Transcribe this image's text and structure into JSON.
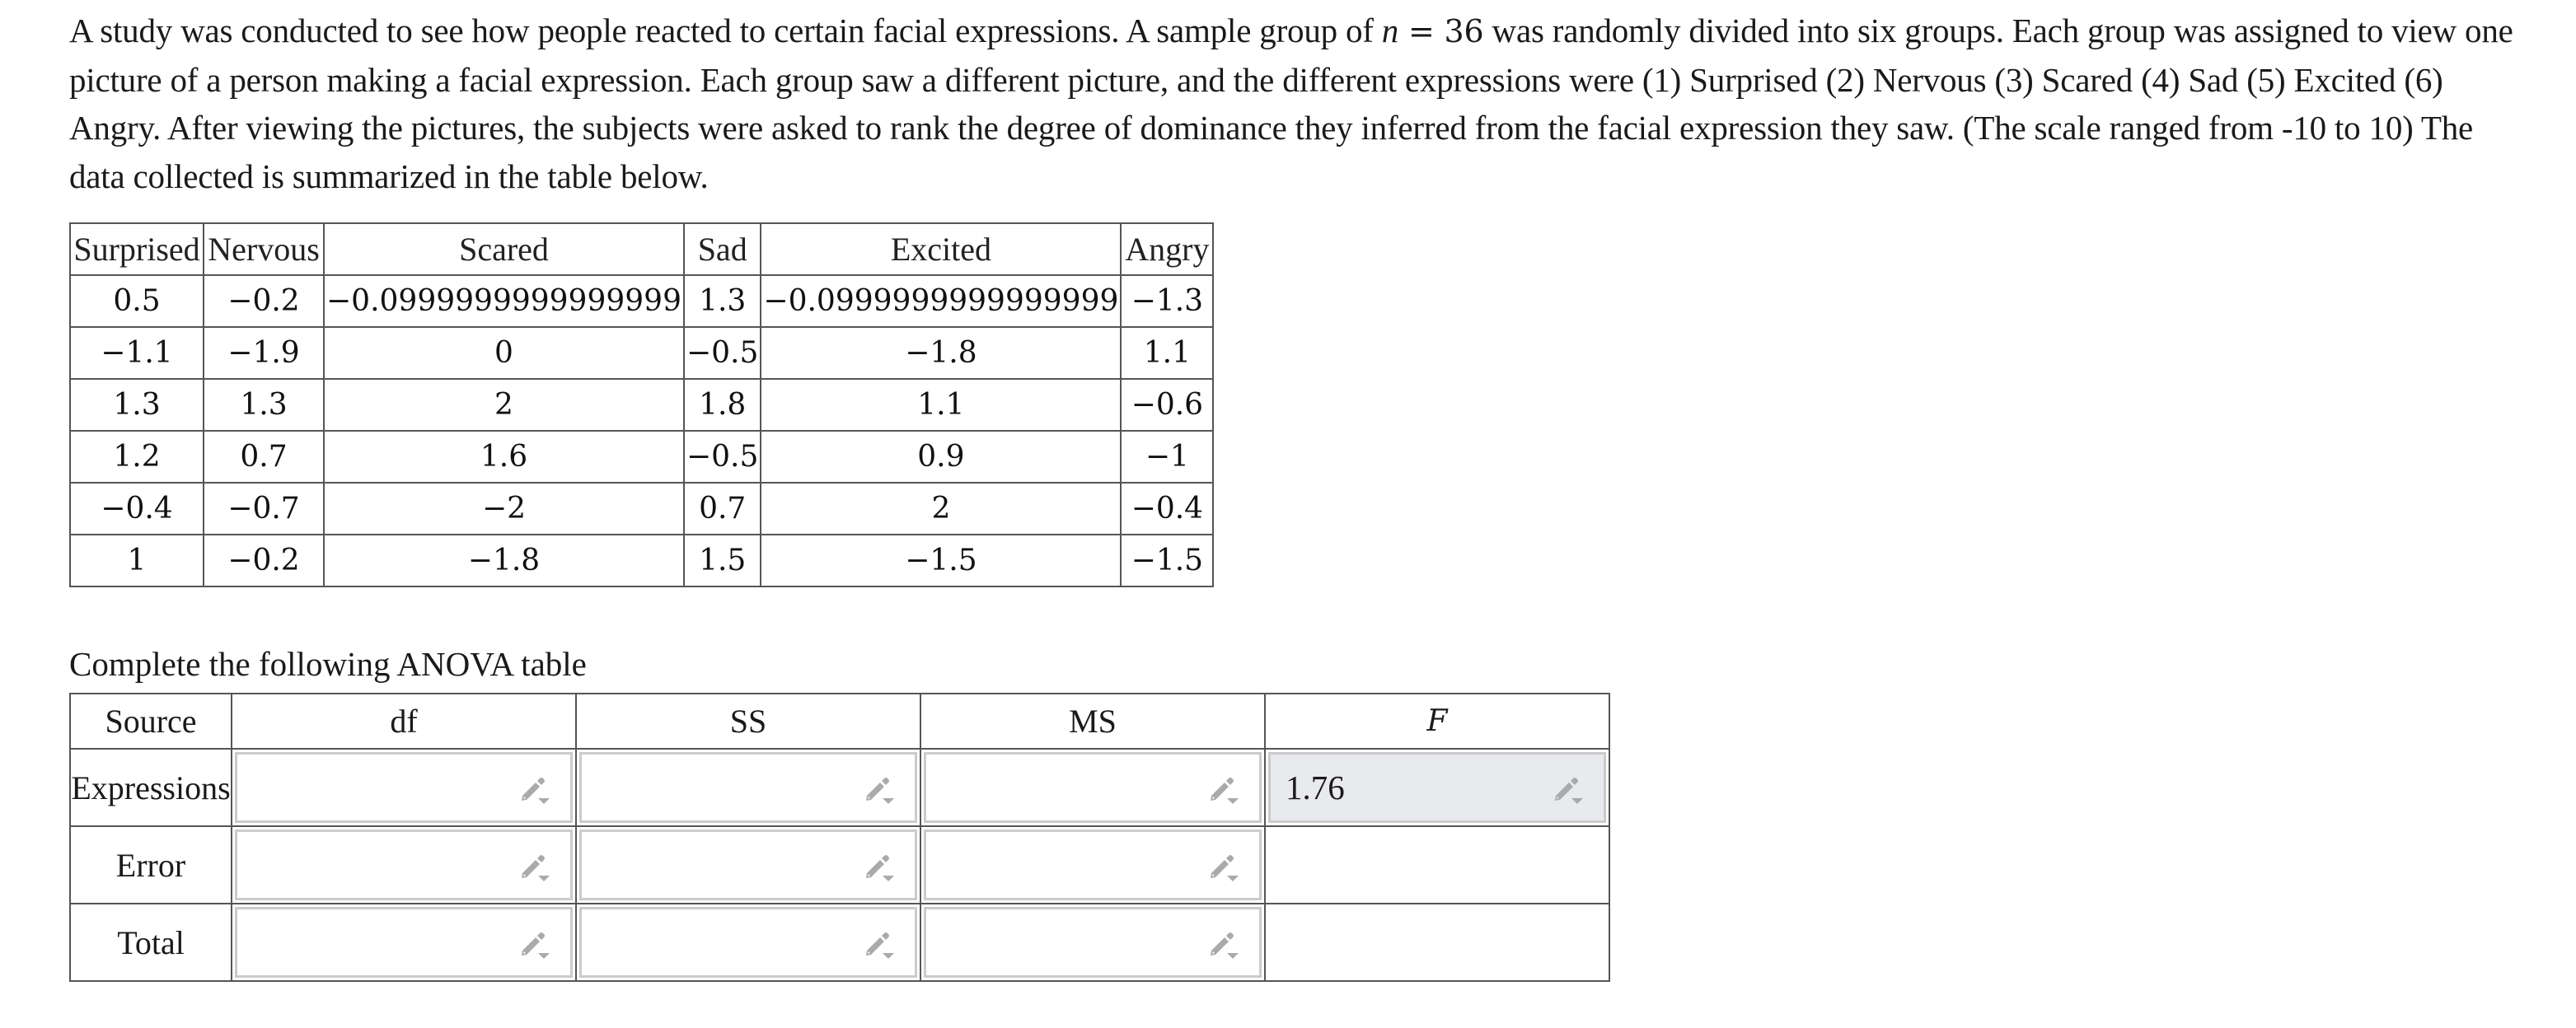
{
  "intro": {
    "part1": "A study was conducted to see how people reacted to certain facial expressions. A sample group of ",
    "n_var": "n",
    "equals": " = ",
    "n_value": "36",
    "part2": " was randomly divided into six groups. Each group was assigned to view one picture of a person making a facial expression. Each group saw a different picture, and the different expressions were (1) Surprised (2) Nervous (3) Scared (4) Sad (5) Excited (6) Angry. After viewing the pictures, the subjects were asked to rank the degree of dominance they inferred from the facial expression they saw. (The scale ranged from -10 to 10) The data collected is summarized in the table below."
  },
  "data_table": {
    "headers": [
      "Surprised",
      "Nervous",
      "Scared",
      "Sad",
      "Excited",
      "Angry"
    ],
    "rows": [
      [
        "0.5",
        "−0.2",
        "−0.0999999999999999",
        "1.3",
        "−0.0999999999999999",
        "−1.3"
      ],
      [
        "−1.1",
        "−1.9",
        "0",
        "−0.5",
        "−1.8",
        "1.1"
      ],
      [
        "1.3",
        "1.3",
        "2",
        "1.8",
        "1.1",
        "−0.6"
      ],
      [
        "1.2",
        "0.7",
        "1.6",
        "−0.5",
        "0.9",
        "−1"
      ],
      [
        "−0.4",
        "−0.7",
        "−2",
        "0.7",
        "2",
        "−0.4"
      ],
      [
        "1",
        "−0.2",
        "−1.8",
        "1.5",
        "−1.5",
        "−1.5"
      ]
    ]
  },
  "anova": {
    "caption": "Complete the following ANOVA table",
    "headers": {
      "source": "Source",
      "df": "df",
      "ss": "SS",
      "ms": "MS",
      "f": "F"
    },
    "rows": [
      {
        "source": "Expressions",
        "df": "",
        "ss": "",
        "ms": "",
        "f": "1.76"
      },
      {
        "source": "Error",
        "df": "",
        "ss": "",
        "ms": ""
      },
      {
        "source": "Total",
        "df": "",
        "ss": "",
        "ms": ""
      }
    ],
    "icons": {
      "input_edit": "pencil-dropdown-icon"
    },
    "colors": {
      "filled_input_bg": "#e9eaed",
      "input_border": "#cbcbcb",
      "icon": "#a9aaac"
    }
  }
}
